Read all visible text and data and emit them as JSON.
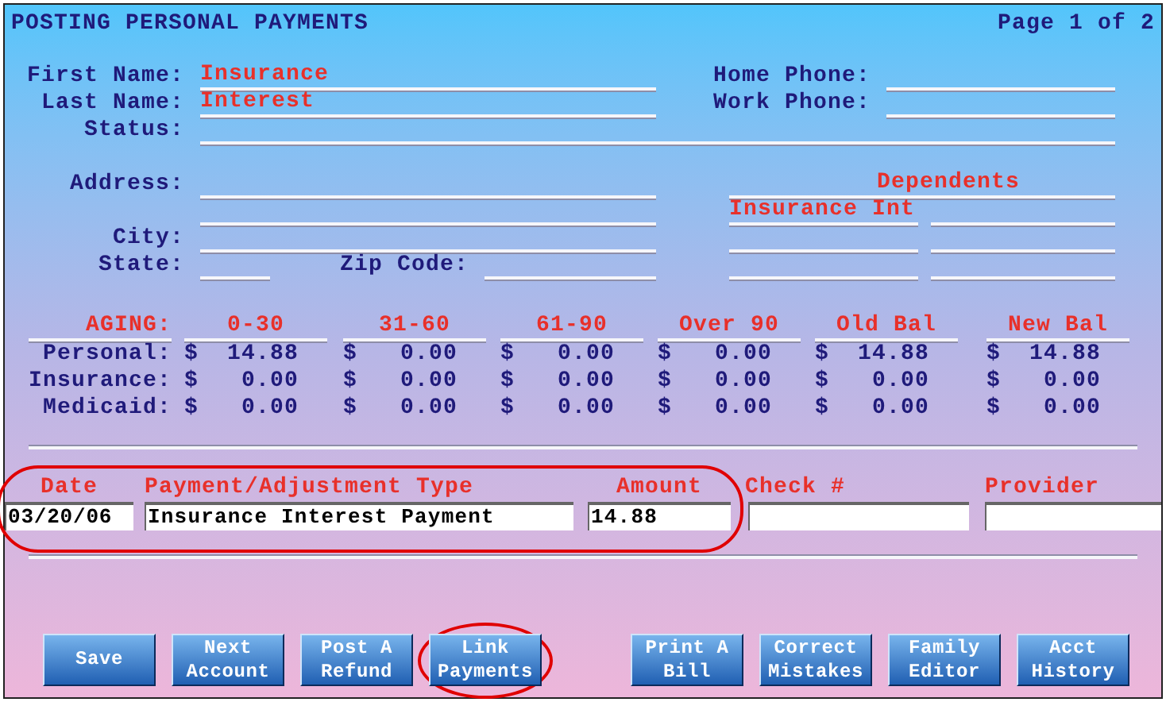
{
  "header": {
    "title": "POSTING PERSONAL PAYMENTS",
    "page": "Page 1 of 2"
  },
  "name_fields": [
    {
      "label": "First Name:",
      "value": "Insurance"
    },
    {
      "label": "Last Name:",
      "value": "Interest"
    }
  ],
  "phone_fields": [
    {
      "label": "Home Phone:"
    },
    {
      "label": "Work Phone:"
    }
  ],
  "status": {
    "label": "Status:"
  },
  "address": {
    "label": "Address:"
  },
  "city": {
    "label": "City:"
  },
  "state": {
    "label": "State:"
  },
  "zip": {
    "label": "Zip Code:"
  },
  "dependents": {
    "title": "Dependents",
    "items": [
      "Insurance Int"
    ]
  },
  "aging": {
    "currency": "$",
    "columns": [
      "AGING:",
      "0-30",
      "31-60",
      "61-90",
      "Over 90",
      "Old Bal",
      "New Bal"
    ],
    "rows": [
      {
        "label": "Personal:",
        "values": [
          "14.88",
          "0.00",
          "0.00",
          "0.00",
          "14.88",
          "14.88"
        ]
      },
      {
        "label": "Insurance:",
        "values": [
          "0.00",
          "0.00",
          "0.00",
          "0.00",
          "0.00",
          "0.00"
        ]
      },
      {
        "label": "Medicaid:",
        "values": [
          "0.00",
          "0.00",
          "0.00",
          "0.00",
          "0.00",
          "0.00"
        ]
      }
    ]
  },
  "payment": {
    "highlighted": true,
    "date": {
      "label": "Date",
      "value": "03/20/06"
    },
    "type": {
      "label": "Payment/Adjustment Type",
      "value": "Insurance Interest Payment"
    },
    "amount": {
      "label": "Amount",
      "value": "14.88"
    },
    "check": {
      "label": "Check #"
    },
    "provider": {
      "label": "Provider"
    }
  },
  "button_groups": [
    [
      {
        "lines": [
          "Save"
        ],
        "highlighted": false
      },
      {
        "lines": [
          "Next",
          "Account"
        ],
        "highlighted": false
      },
      {
        "lines": [
          "Post A",
          "Refund"
        ],
        "highlighted": false
      },
      {
        "lines": [
          "Link",
          "Payments"
        ],
        "highlighted": true
      }
    ],
    [
      {
        "lines": [
          "Print A",
          "Bill"
        ],
        "highlighted": false
      },
      {
        "lines": [
          "Correct",
          "Mistakes"
        ],
        "highlighted": false
      },
      {
        "lines": [
          "Family",
          "Editor"
        ],
        "highlighted": false
      },
      {
        "lines": [
          "Acct",
          "History"
        ],
        "highlighted": false
      }
    ]
  ]
}
